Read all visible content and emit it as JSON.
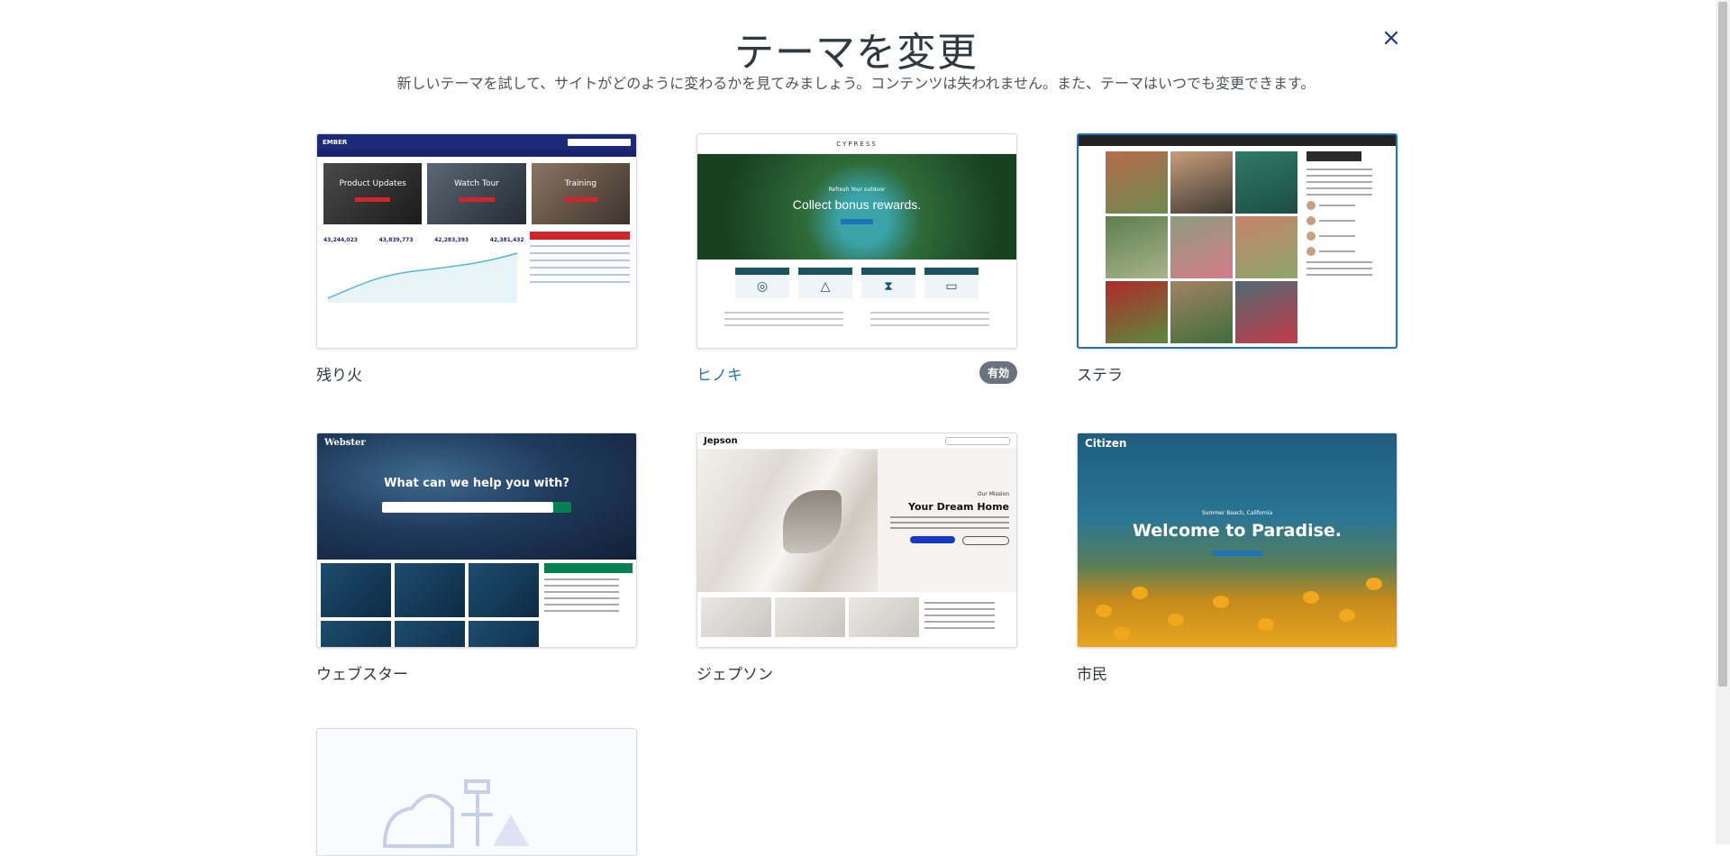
{
  "header": {
    "title": "テーマを変更",
    "subtitle": "新しいテーマを試して、サイトがどのように変わるかを見てみましょう。コンテンツは失われません。また、テーマはいつでも変更できます。"
  },
  "themes": [
    {
      "name": "残り火",
      "active": false
    },
    {
      "name": "ヒノキ",
      "active": true,
      "badge": "有効"
    },
    {
      "name": "ステラ",
      "active": false,
      "selected": true
    },
    {
      "name": "ウェブスター",
      "active": false
    },
    {
      "name": "ジェプソン",
      "active": false
    },
    {
      "name": "市民",
      "active": false
    },
    {
      "name": "",
      "active": false
    }
  ],
  "previews": {
    "ember": {
      "logo": "EMBER",
      "tiles": [
        "Product Updates",
        "Watch Tour",
        "Training"
      ],
      "stats": [
        "43,244,023",
        "43,839,773",
        "42,283,393",
        "42,381,432"
      ]
    },
    "hinoki": {
      "logo": "CYPRESS",
      "hero_small": "Refresh Your outdoor",
      "hero": "Collect bonus rewards."
    },
    "webster": {
      "logo": "Webster",
      "question": "What can we help you with?"
    },
    "jepson": {
      "logo": "Jepson",
      "mission": "Our Mission",
      "heading": "Your Dream Home"
    },
    "citizen": {
      "logo": "Citizen",
      "sub": "Summer Beach, California",
      "heading": "Welcome to Paradise."
    }
  },
  "colors": {
    "accent": "#1f73b7",
    "badge_bg": "#68737d"
  }
}
